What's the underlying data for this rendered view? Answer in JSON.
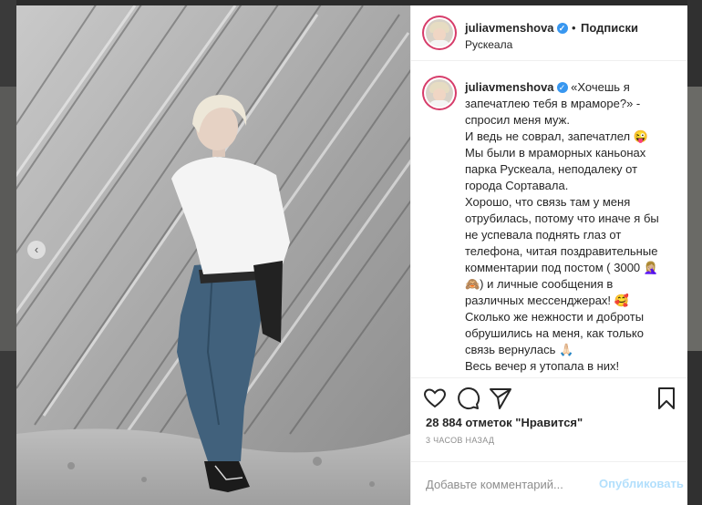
{
  "post": {
    "username": "juliavmenshova",
    "verified_icon": "verified-badge-icon",
    "separator": "•",
    "follow_label": "Подписки",
    "location": "Рускеала",
    "caption": "«Хочешь я запечатлею тебя в мраморе?» - спросил меня муж.\nИ ведь не соврал, запечатлел 😜\nМы были в мраморных каньонах парка Рускеала, неподалеку от города Сортавала.\nХорошо, что связь там у меня отрубилась, потому что иначе я бы не успевала поднять глаз от телефона, читая поздравительные комментарии под постом ( 3000 🤦🏼‍♀️🙈) и личные сообщения в различных мессенджерах! 🥰\nСколько же нежности и доброты обрушились на меня, как только связь вернулась 🙏🏻\nВесь вечер я утопала в них!\nИ несмотря на то, что этот день рождения в привычном формате - в",
    "likes_text": "28 884 отметок \"Нравится\"",
    "time_ago": "3 часов назад",
    "comment_placeholder": "Добавьте комментарий...",
    "publish_label": "Опубликовать"
  },
  "icons": {
    "carousel_prev": "chevron-left-icon",
    "like": "heart-icon",
    "comment": "comment-bubble-icon",
    "share": "paper-plane-icon",
    "save": "bookmark-icon"
  },
  "colors": {
    "ring": "#d63c6a",
    "verified": "#3897f0",
    "publish_disabled": "#b2dffc",
    "text": "#262626",
    "muted": "#8e8e8e"
  }
}
